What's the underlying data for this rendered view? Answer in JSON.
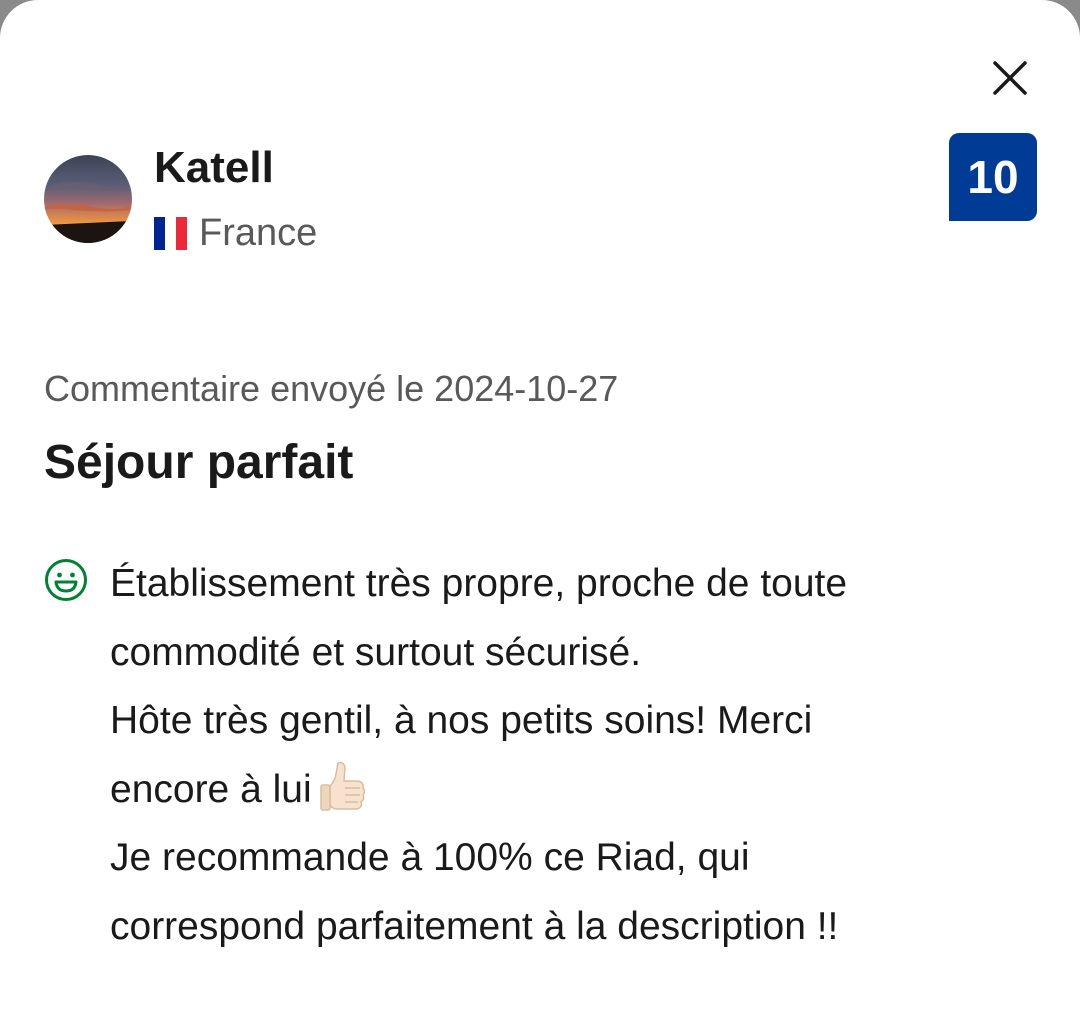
{
  "reviewer": {
    "name": "Katell",
    "country": "France"
  },
  "score": "10",
  "review": {
    "date_line": "Commentaire envoyé le 2024-10-27",
    "title": "Séjour parfait",
    "positive_lines": [
      "Établissement très propre, proche de toute",
      "commodité et surtout sécurisé.",
      "Hôte très gentil, à nos petits soins! Merci",
      "encore à lui",
      "Je recommande à 100% ce Riad, qui",
      "correspond parfaitement à la description !!"
    ]
  },
  "icons": {
    "close": "close-icon",
    "positive": "smiley-icon",
    "thumbs_up": "thumbs-up-emoji",
    "flag": "france-flag-icon"
  },
  "colors": {
    "score_badge": "#003b95",
    "positive_icon": "#008234",
    "flag_blue": "#002395",
    "flag_white": "#ffffff",
    "flag_red": "#ed2939"
  }
}
